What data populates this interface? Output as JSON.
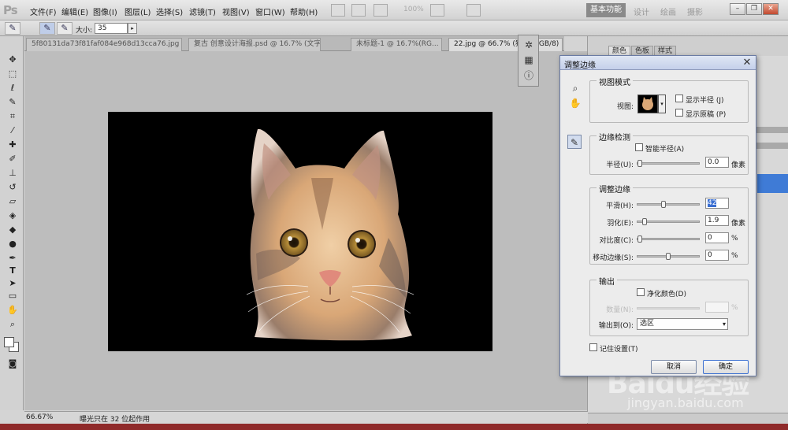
{
  "app": {
    "logo": "Ps"
  },
  "menu": [
    "文件(F)",
    "编辑(E)",
    "图像(I)",
    "图层(L)",
    "选择(S)",
    "滤镜(T)",
    "视图(V)",
    "窗口(W)",
    "帮助(H)"
  ],
  "menubar_extra": {
    "zoom": "100%"
  },
  "workspaces": {
    "active": "基本功能",
    "items": [
      "设计",
      "绘画",
      "摄影"
    ]
  },
  "options_bar": {
    "size_label": "大小:",
    "size_value": "35"
  },
  "doc_tabs": [
    "5f80131da73f81faf084e968d13cca76.jpg",
    "复古 创意设计海报.psd @ 16.7% (文字, RG...",
    "未标题-1 @ 16.7%(RG...",
    "22.jpg @ 66.7% (猫咪, RGB/8)"
  ],
  "status": {
    "zoom": "66.67%",
    "info": "曝光只在 32 位起作用"
  },
  "right_panel": {
    "tabs": [
      "颜色",
      "色板",
      "样式"
    ]
  },
  "dialog": {
    "title": "调整边缘",
    "view_mode": {
      "legend": "视图模式",
      "view_label": "视图:",
      "show_radius": "显示半径 (J)",
      "show_original": "显示原稿 (P)"
    },
    "edge_detection": {
      "legend": "边缘检测",
      "smart_radius": "智能半径(A)",
      "radius_label": "半径(U):",
      "radius_value": "0.0",
      "radius_unit": "像素",
      "radius_level": 0
    },
    "adjust_edge": {
      "legend": "调整边缘",
      "smooth_label": "平滑(H):",
      "smooth_value": "42",
      "smooth_level": 0.42,
      "feather_label": "羽化(E):",
      "feather_value": "1.9",
      "feather_unit": "像素",
      "feather_level": 0.08,
      "contrast_label": "对比度(C):",
      "contrast_value": "0",
      "contrast_unit": "%",
      "contrast_level": 0,
      "shift_label": "移动边缘(S):",
      "shift_value": "0",
      "shift_unit": "%",
      "shift_level": 0.5
    },
    "output": {
      "legend": "输出",
      "decontaminate": "净化颜色(D)",
      "amount_label": "数量(N):",
      "amount_unit": "%",
      "output_to_label": "输出到(O):",
      "output_to_value": "选区"
    },
    "remember": "记住设置(T)",
    "cancel": "取消",
    "ok": "确定"
  },
  "watermark": {
    "main": "Baidu经验",
    "sub": "jingyan.baidu.com"
  },
  "colors": {
    "accent": "#3a6fd1",
    "dialog_border": "#6a7ba4",
    "canvas_bg": "#000000"
  }
}
